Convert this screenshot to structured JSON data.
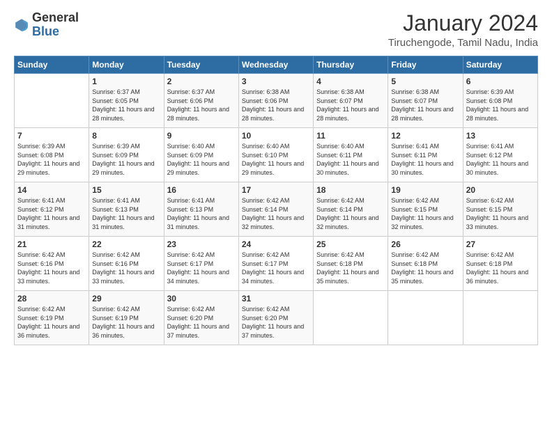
{
  "logo": {
    "general": "General",
    "blue": "Blue"
  },
  "title": "January 2024",
  "location": "Tiruchengode, Tamil Nadu, India",
  "headers": [
    "Sunday",
    "Monday",
    "Tuesday",
    "Wednesday",
    "Thursday",
    "Friday",
    "Saturday"
  ],
  "weeks": [
    [
      {
        "day": "",
        "sunrise": "",
        "sunset": "",
        "daylight": ""
      },
      {
        "day": "1",
        "sunrise": "Sunrise: 6:37 AM",
        "sunset": "Sunset: 6:05 PM",
        "daylight": "Daylight: 11 hours and 28 minutes."
      },
      {
        "day": "2",
        "sunrise": "Sunrise: 6:37 AM",
        "sunset": "Sunset: 6:06 PM",
        "daylight": "Daylight: 11 hours and 28 minutes."
      },
      {
        "day": "3",
        "sunrise": "Sunrise: 6:38 AM",
        "sunset": "Sunset: 6:06 PM",
        "daylight": "Daylight: 11 hours and 28 minutes."
      },
      {
        "day": "4",
        "sunrise": "Sunrise: 6:38 AM",
        "sunset": "Sunset: 6:07 PM",
        "daylight": "Daylight: 11 hours and 28 minutes."
      },
      {
        "day": "5",
        "sunrise": "Sunrise: 6:38 AM",
        "sunset": "Sunset: 6:07 PM",
        "daylight": "Daylight: 11 hours and 28 minutes."
      },
      {
        "day": "6",
        "sunrise": "Sunrise: 6:39 AM",
        "sunset": "Sunset: 6:08 PM",
        "daylight": "Daylight: 11 hours and 28 minutes."
      }
    ],
    [
      {
        "day": "7",
        "sunrise": "Sunrise: 6:39 AM",
        "sunset": "Sunset: 6:08 PM",
        "daylight": "Daylight: 11 hours and 29 minutes."
      },
      {
        "day": "8",
        "sunrise": "Sunrise: 6:39 AM",
        "sunset": "Sunset: 6:09 PM",
        "daylight": "Daylight: 11 hours and 29 minutes."
      },
      {
        "day": "9",
        "sunrise": "Sunrise: 6:40 AM",
        "sunset": "Sunset: 6:09 PM",
        "daylight": "Daylight: 11 hours and 29 minutes."
      },
      {
        "day": "10",
        "sunrise": "Sunrise: 6:40 AM",
        "sunset": "Sunset: 6:10 PM",
        "daylight": "Daylight: 11 hours and 29 minutes."
      },
      {
        "day": "11",
        "sunrise": "Sunrise: 6:40 AM",
        "sunset": "Sunset: 6:11 PM",
        "daylight": "Daylight: 11 hours and 30 minutes."
      },
      {
        "day": "12",
        "sunrise": "Sunrise: 6:41 AM",
        "sunset": "Sunset: 6:11 PM",
        "daylight": "Daylight: 11 hours and 30 minutes."
      },
      {
        "day": "13",
        "sunrise": "Sunrise: 6:41 AM",
        "sunset": "Sunset: 6:12 PM",
        "daylight": "Daylight: 11 hours and 30 minutes."
      }
    ],
    [
      {
        "day": "14",
        "sunrise": "Sunrise: 6:41 AM",
        "sunset": "Sunset: 6:12 PM",
        "daylight": "Daylight: 11 hours and 31 minutes."
      },
      {
        "day": "15",
        "sunrise": "Sunrise: 6:41 AM",
        "sunset": "Sunset: 6:13 PM",
        "daylight": "Daylight: 11 hours and 31 minutes."
      },
      {
        "day": "16",
        "sunrise": "Sunrise: 6:41 AM",
        "sunset": "Sunset: 6:13 PM",
        "daylight": "Daylight: 11 hours and 31 minutes."
      },
      {
        "day": "17",
        "sunrise": "Sunrise: 6:42 AM",
        "sunset": "Sunset: 6:14 PM",
        "daylight": "Daylight: 11 hours and 32 minutes."
      },
      {
        "day": "18",
        "sunrise": "Sunrise: 6:42 AM",
        "sunset": "Sunset: 6:14 PM",
        "daylight": "Daylight: 11 hours and 32 minutes."
      },
      {
        "day": "19",
        "sunrise": "Sunrise: 6:42 AM",
        "sunset": "Sunset: 6:15 PM",
        "daylight": "Daylight: 11 hours and 32 minutes."
      },
      {
        "day": "20",
        "sunrise": "Sunrise: 6:42 AM",
        "sunset": "Sunset: 6:15 PM",
        "daylight": "Daylight: 11 hours and 33 minutes."
      }
    ],
    [
      {
        "day": "21",
        "sunrise": "Sunrise: 6:42 AM",
        "sunset": "Sunset: 6:16 PM",
        "daylight": "Daylight: 11 hours and 33 minutes."
      },
      {
        "day": "22",
        "sunrise": "Sunrise: 6:42 AM",
        "sunset": "Sunset: 6:16 PM",
        "daylight": "Daylight: 11 hours and 33 minutes."
      },
      {
        "day": "23",
        "sunrise": "Sunrise: 6:42 AM",
        "sunset": "Sunset: 6:17 PM",
        "daylight": "Daylight: 11 hours and 34 minutes."
      },
      {
        "day": "24",
        "sunrise": "Sunrise: 6:42 AM",
        "sunset": "Sunset: 6:17 PM",
        "daylight": "Daylight: 11 hours and 34 minutes."
      },
      {
        "day": "25",
        "sunrise": "Sunrise: 6:42 AM",
        "sunset": "Sunset: 6:18 PM",
        "daylight": "Daylight: 11 hours and 35 minutes."
      },
      {
        "day": "26",
        "sunrise": "Sunrise: 6:42 AM",
        "sunset": "Sunset: 6:18 PM",
        "daylight": "Daylight: 11 hours and 35 minutes."
      },
      {
        "day": "27",
        "sunrise": "Sunrise: 6:42 AM",
        "sunset": "Sunset: 6:18 PM",
        "daylight": "Daylight: 11 hours and 36 minutes."
      }
    ],
    [
      {
        "day": "28",
        "sunrise": "Sunrise: 6:42 AM",
        "sunset": "Sunset: 6:19 PM",
        "daylight": "Daylight: 11 hours and 36 minutes."
      },
      {
        "day": "29",
        "sunrise": "Sunrise: 6:42 AM",
        "sunset": "Sunset: 6:19 PM",
        "daylight": "Daylight: 11 hours and 36 minutes."
      },
      {
        "day": "30",
        "sunrise": "Sunrise: 6:42 AM",
        "sunset": "Sunset: 6:20 PM",
        "daylight": "Daylight: 11 hours and 37 minutes."
      },
      {
        "day": "31",
        "sunrise": "Sunrise: 6:42 AM",
        "sunset": "Sunset: 6:20 PM",
        "daylight": "Daylight: 11 hours and 37 minutes."
      },
      {
        "day": "",
        "sunrise": "",
        "sunset": "",
        "daylight": ""
      },
      {
        "day": "",
        "sunrise": "",
        "sunset": "",
        "daylight": ""
      },
      {
        "day": "",
        "sunrise": "",
        "sunset": "",
        "daylight": ""
      }
    ]
  ]
}
